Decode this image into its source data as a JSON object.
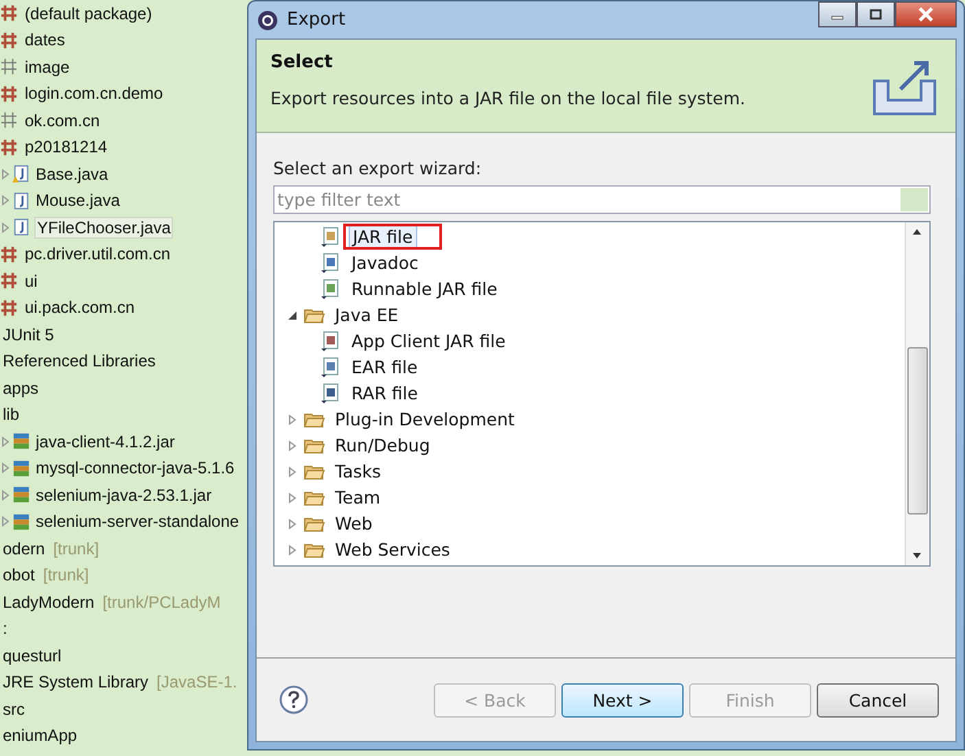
{
  "explorer": {
    "items": [
      {
        "label": "(default package)",
        "kind": "package"
      },
      {
        "label": "dates",
        "kind": "package"
      },
      {
        "label": "image",
        "kind": "empty-package"
      },
      {
        "label": "login.com.cn.demo",
        "kind": "package"
      },
      {
        "label": "ok.com.cn",
        "kind": "empty-package"
      },
      {
        "label": "p20181214",
        "kind": "package",
        "children": [
          {
            "label": "Base.java",
            "kind": "java",
            "warning": true
          },
          {
            "label": "Mouse.java",
            "kind": "java",
            "warning": false
          },
          {
            "label": "YFileChooser.java",
            "kind": "java",
            "warning": false,
            "selected": true
          }
        ]
      },
      {
        "label": "pc.driver.util.com.cn",
        "kind": "package"
      },
      {
        "label": "ui",
        "kind": "package"
      },
      {
        "label": "ui.pack.com.cn",
        "kind": "package"
      },
      {
        "label": "JUnit 5",
        "kind": "plain"
      },
      {
        "label": "Referenced Libraries",
        "kind": "plain"
      },
      {
        "label": "apps",
        "kind": "plain"
      },
      {
        "label": "lib",
        "kind": "plain",
        "children": [
          {
            "label": "java-client-4.1.2.jar",
            "kind": "jar"
          },
          {
            "label": "mysql-connector-java-5.1.6",
            "kind": "jar"
          },
          {
            "label": "selenium-java-2.53.1.jar",
            "kind": "jar"
          },
          {
            "label": "selenium-server-standalone",
            "kind": "jar"
          }
        ]
      },
      {
        "label": "odern",
        "kind": "plain",
        "decoration": "[trunk]"
      },
      {
        "label": "obot",
        "kind": "plain",
        "decoration": "[trunk]"
      },
      {
        "label": "LadyModern",
        "kind": "plain",
        "decoration": "[trunk/PCLadyM"
      },
      {
        "label": ":",
        "kind": "plain"
      },
      {
        "label": "questurl",
        "kind": "plain"
      },
      {
        "label": "JRE System Library",
        "kind": "plain",
        "decoration": "[JavaSE-1."
      },
      {
        "label": "src",
        "kind": "plain"
      },
      {
        "label": "eniumApp",
        "kind": "plain"
      }
    ]
  },
  "dialog": {
    "title": "Export",
    "heading": "Select",
    "description": "Export resources into a JAR file on the local file system.",
    "wizard_label": "Select an export wizard:",
    "filter": {
      "placeholder": "type filter text"
    },
    "tree": {
      "scrolled_children": [
        {
          "label": "JAR file",
          "kind": "jar",
          "selected": true
        },
        {
          "label": "Javadoc",
          "kind": "javadoc",
          "selected": false
        },
        {
          "label": "Runnable JAR file",
          "kind": "runnable",
          "selected": false
        }
      ],
      "items": [
        {
          "label": "Java EE",
          "kind": "folder",
          "expanded": true,
          "children": [
            {
              "label": "App Client JAR file",
              "kind": "appclient",
              "selected": false
            },
            {
              "label": "EAR file",
              "kind": "ear",
              "selected": false
            },
            {
              "label": "RAR file",
              "kind": "rar",
              "selected": false
            }
          ]
        },
        {
          "label": "Plug-in Development",
          "kind": "folder",
          "expanded": false
        },
        {
          "label": "Run/Debug",
          "kind": "folder",
          "expanded": false
        },
        {
          "label": "Tasks",
          "kind": "folder",
          "expanded": false
        },
        {
          "label": "Team",
          "kind": "folder",
          "expanded": false
        },
        {
          "label": "Web",
          "kind": "folder",
          "expanded": false
        },
        {
          "label": "Web Services",
          "kind": "folder",
          "expanded": false
        }
      ]
    },
    "buttons": [
      {
        "label": "< Back",
        "disabled": true,
        "default": false
      },
      {
        "label": "Next >",
        "disabled": false,
        "default": true
      },
      {
        "label": "Finish",
        "disabled": true,
        "default": false
      },
      {
        "label": "Cancel",
        "disabled": false,
        "default": false
      }
    ]
  }
}
